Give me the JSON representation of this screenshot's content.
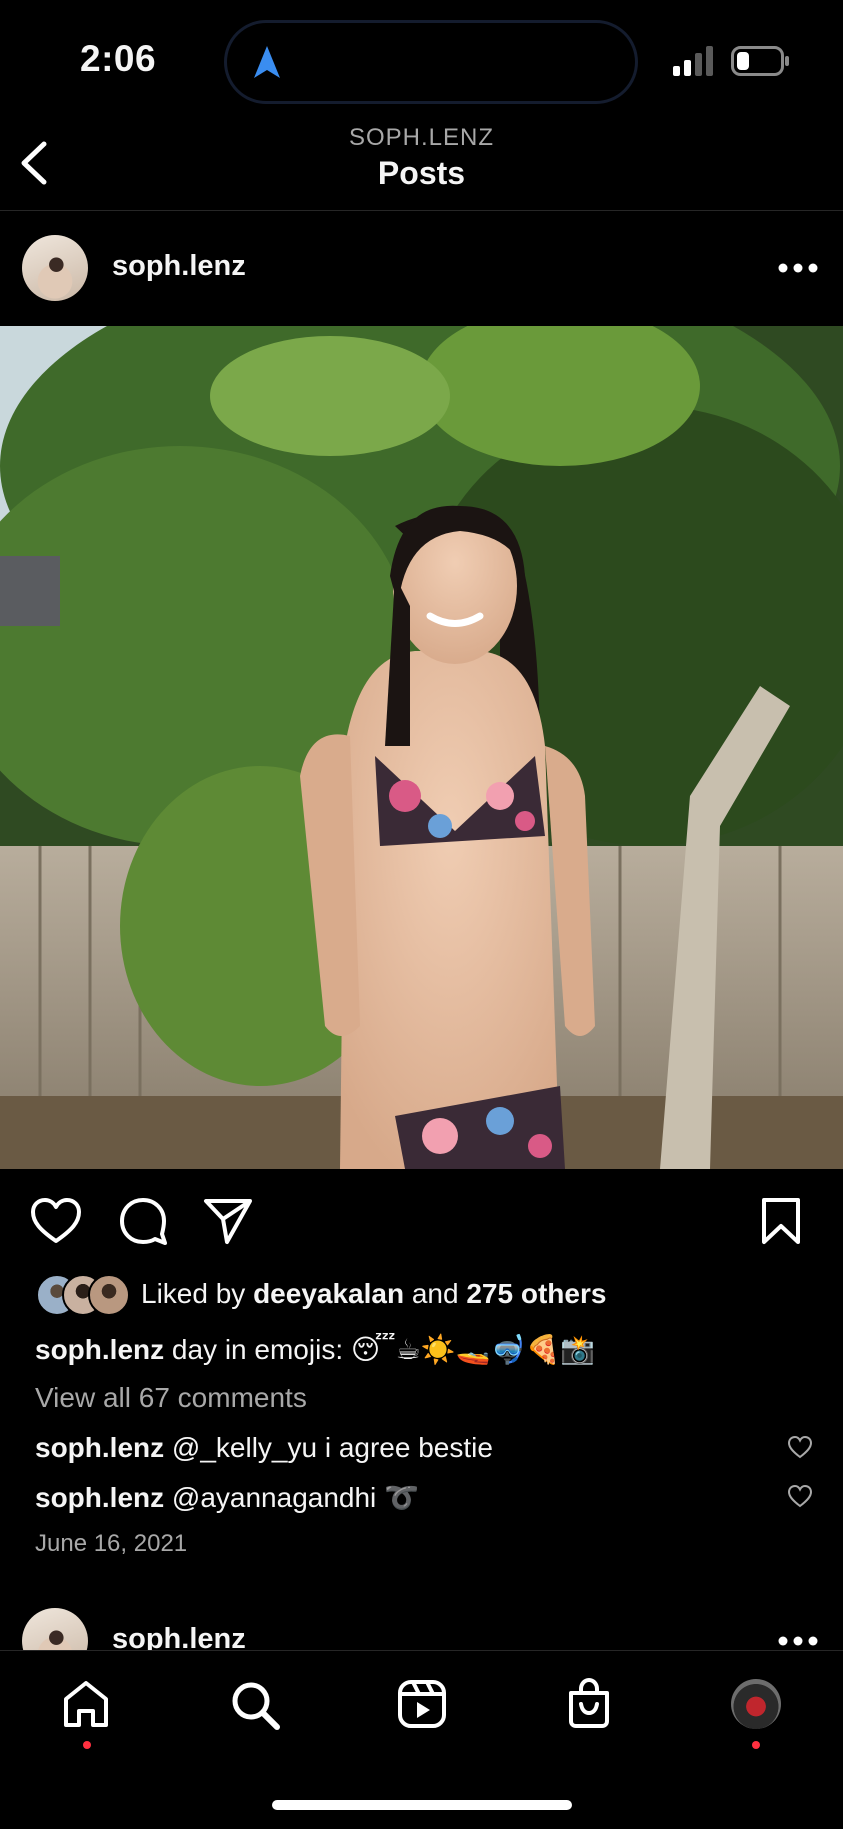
{
  "status": {
    "time": "2:06"
  },
  "header": {
    "account_handle": "SOPH.LENZ",
    "title": "Posts"
  },
  "post": {
    "username": "soph.lenz",
    "liked_by_prefix": "Liked by",
    "liked_by_user": "deeyakalan",
    "liked_by_and": "and",
    "liked_by_others": "275 others",
    "caption_user": "soph.lenz",
    "caption_text": "day in emojis: 😴☕☀️🚤🤿🍕📸",
    "view_comments": "View all 67 comments",
    "comments": [
      {
        "user": "soph.lenz",
        "text": "@_kelly_yu i agree bestie"
      },
      {
        "user": "soph.lenz",
        "text": "@ayannagandhi ➰"
      }
    ],
    "date": "June 16, 2021"
  },
  "next_post": {
    "username": "soph.lenz"
  },
  "icons": {
    "back": "chevron-left-icon",
    "like": "heart-icon",
    "comment": "comment-bubble-icon",
    "share": "paper-plane-icon",
    "save": "bookmark-icon",
    "more": "ellipsis-icon",
    "tabs": [
      "home-icon",
      "search-icon",
      "reels-icon",
      "shop-icon",
      "profile-avatar"
    ]
  },
  "colors": {
    "background": "#000000",
    "text": "#f5f5f5",
    "muted": "#a8a8a8",
    "notification_dot": "#ff3040",
    "nav_arrow": "#3a8df0"
  }
}
